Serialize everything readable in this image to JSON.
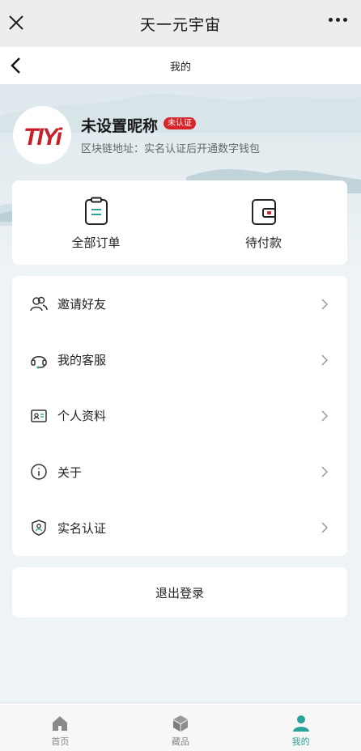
{
  "wechat": {
    "title": "天一元宇宙"
  },
  "nav": {
    "title": "我的"
  },
  "profile": {
    "logo_text": "TIYi",
    "nickname": "未设置昵称",
    "badge": "未认证",
    "chain_address": "区块链地址：实名认证后开通数字钱包"
  },
  "orders": [
    {
      "label": "全部订单",
      "icon": "clipboard-icon"
    },
    {
      "label": "待付款",
      "icon": "wallet-icon"
    }
  ],
  "menu": [
    {
      "label": "邀请好友",
      "icon": "friends-icon"
    },
    {
      "label": "我的客服",
      "icon": "headset-icon"
    },
    {
      "label": "个人资料",
      "icon": "id-card-icon"
    },
    {
      "label": "关于",
      "icon": "info-icon"
    },
    {
      "label": "实名认证",
      "icon": "shield-user-icon"
    }
  ],
  "logout": {
    "label": "退出登录"
  },
  "tabs": [
    {
      "label": "首页",
      "icon": "home-icon"
    },
    {
      "label": "藏品",
      "icon": "cube-icon"
    },
    {
      "label": "我的",
      "icon": "user-icon",
      "active": true
    }
  ],
  "colors": {
    "accent": "#2ba39b",
    "badge": "#d6262b",
    "logo": "#c8202a"
  }
}
